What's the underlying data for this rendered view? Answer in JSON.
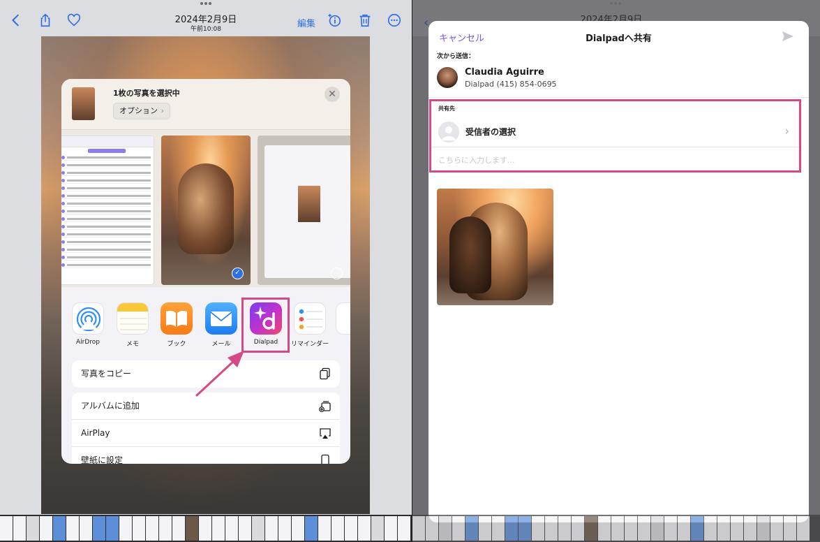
{
  "left": {
    "toolbar": {
      "date": "2024年2月9日",
      "time": "午前10:08",
      "edit_label": "編集"
    },
    "sheet": {
      "title": "1枚の写真を選択中",
      "options_label": "オプション",
      "apps": [
        {
          "label": "AirDrop",
          "icon": "airdrop-icon"
        },
        {
          "label": "メモ",
          "icon": "notes-icon"
        },
        {
          "label": "ブック",
          "icon": "books-icon"
        },
        {
          "label": "メール",
          "icon": "mail-icon"
        },
        {
          "label": "Dialpad",
          "icon": "dialpad-icon"
        },
        {
          "label": "リマインダー",
          "icon": "reminders-icon"
        }
      ],
      "actions": [
        {
          "label": "写真をコピー",
          "icon": "copy-icon"
        },
        {
          "label": "アルバムに追加",
          "icon": "album-add-icon"
        },
        {
          "label": "AirPlay",
          "icon": "airplay-icon"
        },
        {
          "label": "壁紙に設定",
          "icon": "wallpaper-icon"
        }
      ]
    },
    "annotation_color": "#d44a87"
  },
  "right": {
    "toolbar": {
      "date": "2024年2月9日"
    },
    "dialpad": {
      "cancel_label": "キャンセル",
      "title": "Dialpadへ共有",
      "from_label": "次から送信：",
      "sender_name": "Claudia  Aguirre",
      "sender_number": "Dialpad (415) 854-0695",
      "share_to_label": "共有先",
      "recipient_placeholder": "受信者の選択",
      "message_placeholder": "こちらに入力します...",
      "accent_color": "#7c52e6"
    }
  }
}
